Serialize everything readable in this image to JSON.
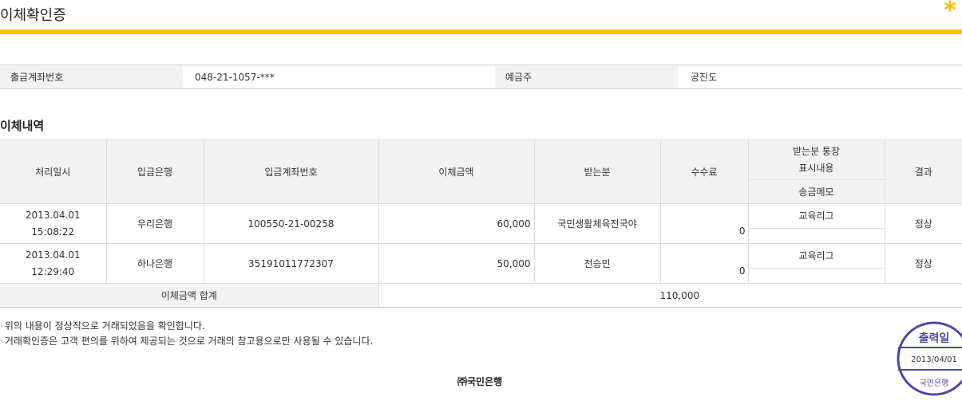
{
  "header": {
    "title": "이체확인증",
    "star": "*"
  },
  "account_info": {
    "withdraw_label": "출금계좌번호",
    "withdraw_value": "048-21-1057-***",
    "holder_label": "예금주",
    "holder_value": "공진도"
  },
  "section_title": "이체내역",
  "table": {
    "headers": {
      "date": "처리일시",
      "bank": "입금은행",
      "account": "입금계좌번호",
      "amount": "이체금액",
      "receiver": "받는분",
      "fee": "수수료",
      "display_top": "받는분 통장",
      "display_bottom": "표시내용",
      "memo": "송금메모",
      "result": "결과"
    },
    "rows": [
      {
        "date": "2013.04.01",
        "time": "15:08:22",
        "bank": "우리은행",
        "account": "100550-21-00258",
        "amount": "60,000",
        "receiver": "국민생활체육전국야",
        "fee": "0",
        "display": "교육리그",
        "memo": "",
        "result": "정상"
      },
      {
        "date": "2013.04.01",
        "time": "12:29:40",
        "bank": "하나은행",
        "account": "35191011772307",
        "amount": "50,000",
        "receiver": "전승민",
        "fee": "0",
        "display": "교육리그",
        "memo": "",
        "result": "정상"
      }
    ],
    "total_label": "이체금액 합계",
    "total_value": "110,000"
  },
  "notes": [
    "위의 내용이 정상적으로 거래되었음을 확인합니다.",
    "거래확인증은 고객 편의를 위하여 제공되는 것으로 거래의 참고용으로만 사용될 수 있습니다."
  ],
  "bank_name": "㈜국민은행",
  "stamp": {
    "top": "출력일",
    "date": "2013/04/01",
    "bottom": "국민은행"
  },
  "colors": {
    "accent": "#f7c300",
    "stamp": "#4a4aa8"
  }
}
